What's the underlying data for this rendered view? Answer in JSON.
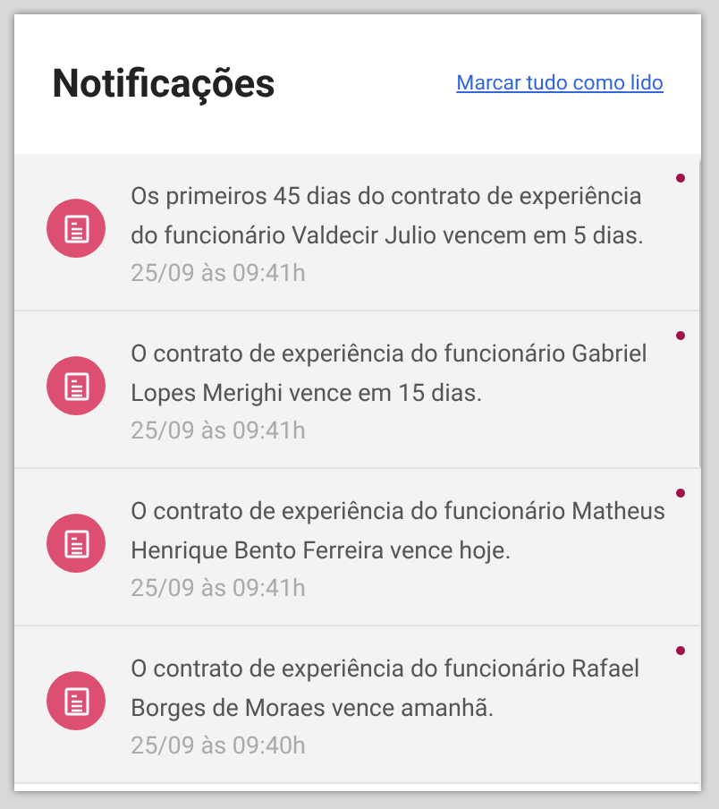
{
  "header": {
    "title": "Notificações",
    "mark_all_link": "Marcar tudo como lido"
  },
  "notifications": [
    {
      "message": "Os primeiros 45 dias do contrato de experiência do funcionário Valdecir Julio vencem em 5 dias.",
      "time": "25/09 às 09:41h",
      "unread": true
    },
    {
      "message": "O contrato de experiência do funcionário Gabriel Lopes Merighi vence em 15 dias.",
      "time": "25/09 às 09:41h",
      "unread": true
    },
    {
      "message": "O contrato de experiência do funcionário Matheus Henrique Bento Ferreira vence hoje.",
      "time": "25/09 às 09:41h",
      "unread": true
    },
    {
      "message": "O contrato de experiência do funcionário Rafael Borges de Moraes vence amanhã.",
      "time": "25/09 às 09:40h",
      "unread": true
    }
  ]
}
